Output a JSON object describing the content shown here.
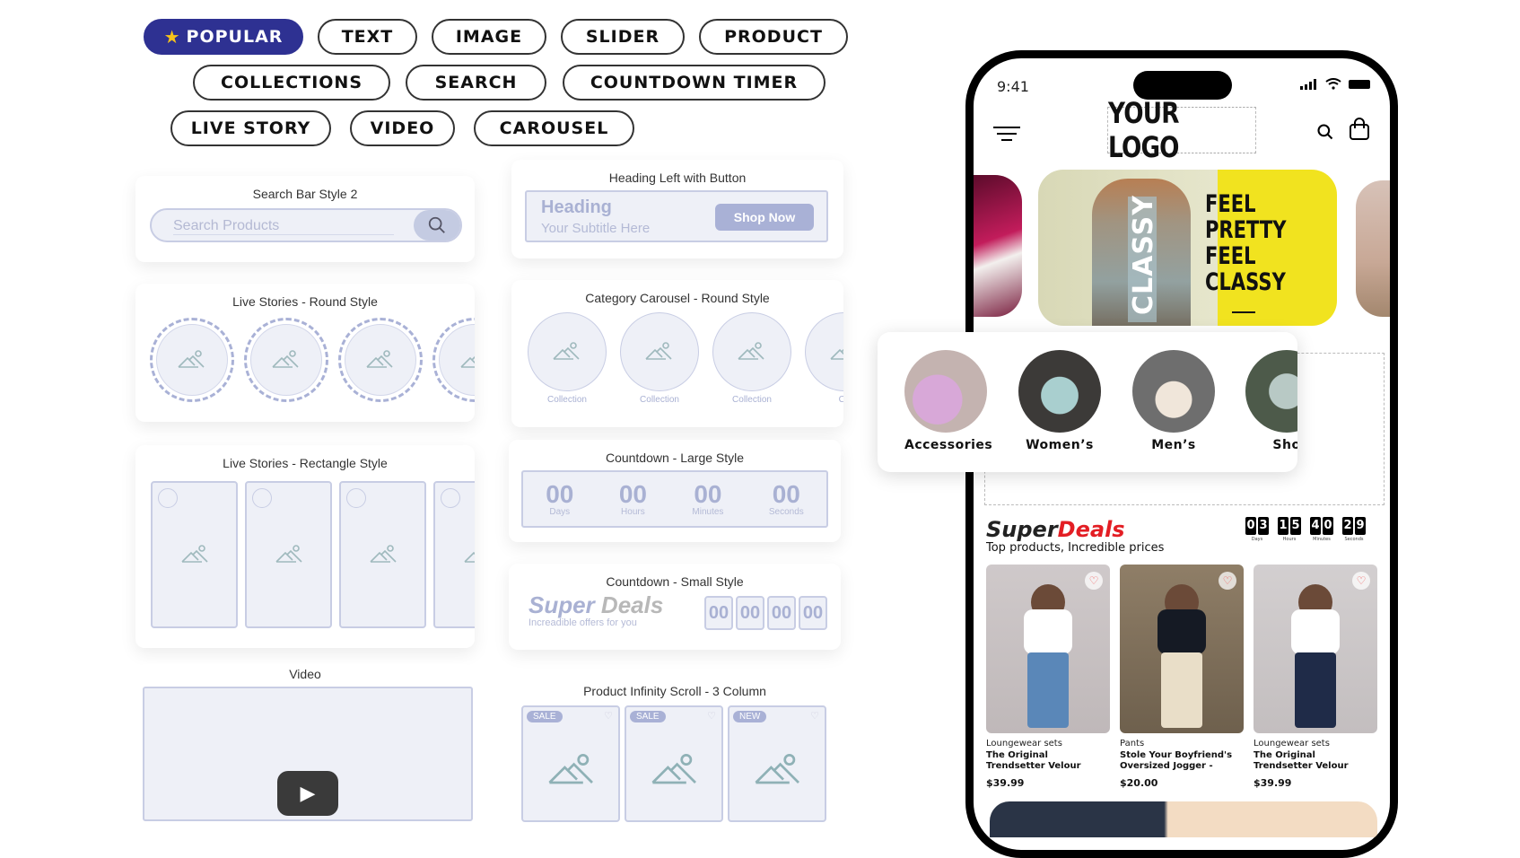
{
  "filters": {
    "chips": [
      {
        "label": "POPULAR",
        "active": true,
        "icon": "star-icon"
      },
      {
        "label": "TEXT"
      },
      {
        "label": "IMAGE"
      },
      {
        "label": "SLIDER"
      },
      {
        "label": "PRODUCT"
      },
      {
        "label": "COLLECTIONS"
      },
      {
        "label": "SEARCH"
      },
      {
        "label": "COUNTDOWN TIMER"
      },
      {
        "label": "LIVE STORY"
      },
      {
        "label": "VIDEO"
      },
      {
        "label": "CAROUSEL"
      }
    ]
  },
  "widgets": {
    "search_bar": {
      "title": "Search Bar Style 2",
      "placeholder": "Search Products"
    },
    "heading_button": {
      "title": "Heading Left with Button",
      "heading": "Heading",
      "subtitle": "Your Subtitle Here",
      "button": "Shop Now"
    },
    "live_round": {
      "title": "Live Stories - Round Style"
    },
    "category_round": {
      "title": "Category Carousel - Round Style",
      "item_label": "Collection",
      "partial_label": "Co"
    },
    "live_rect": {
      "title": "Live Stories - Rectangle Style"
    },
    "countdown_large": {
      "title": "Countdown - Large Style",
      "units": [
        {
          "value": "00",
          "label": "Days"
        },
        {
          "value": "00",
          "label": "Hours"
        },
        {
          "value": "00",
          "label": "Minutes"
        },
        {
          "value": "00",
          "label": "Seconds"
        }
      ]
    },
    "countdown_small": {
      "title": "Countdown - Small Style",
      "heading_a": "Super",
      "heading_b": "Deals",
      "subtitle": "Increadible offers for you",
      "values": [
        "00",
        "00",
        "00",
        "00"
      ]
    },
    "video": {
      "title": "Video"
    },
    "product_scroll": {
      "title": "Product Infinity Scroll - 3 Column",
      "badges": [
        "SALE",
        "SALE",
        "NEW"
      ]
    }
  },
  "phone": {
    "status": {
      "time": "9:41"
    },
    "logo": "YOUR LOGO",
    "banner": {
      "lines": [
        "FEEL",
        "PRETTY",
        "FEEL",
        "CLASSY"
      ],
      "vertical_text": "CLASSY"
    },
    "categories": [
      "Accessories",
      "Women’s",
      "Men’s",
      "Sho"
    ],
    "deals": {
      "title_a": "Super",
      "title_b": "Deals",
      "subtitle": "Top products, Incredible prices",
      "timer": [
        {
          "value": "03",
          "label": "Days"
        },
        {
          "value": "15",
          "label": "Hours"
        },
        {
          "value": "40",
          "label": "Minutes"
        },
        {
          "value": "29",
          "label": "Seconds"
        }
      ]
    },
    "products": [
      {
        "category": "Loungewear sets",
        "name": "The Original Trendsetter Velour",
        "price": "$39.99"
      },
      {
        "category": "Pants",
        "name": "Stole Your Boyfriend's Oversized Jogger -",
        "price": "$20.00"
      },
      {
        "category": "Loungewear sets",
        "name": "The Original Trendsetter Velour",
        "price": "$39.99"
      }
    ]
  },
  "colors": {
    "accent": "#2e3192",
    "star": "#f7c31b",
    "placeholder": "#eef0f7",
    "deals_red": "#e31e24",
    "banner_yellow": "#f1e31f"
  }
}
